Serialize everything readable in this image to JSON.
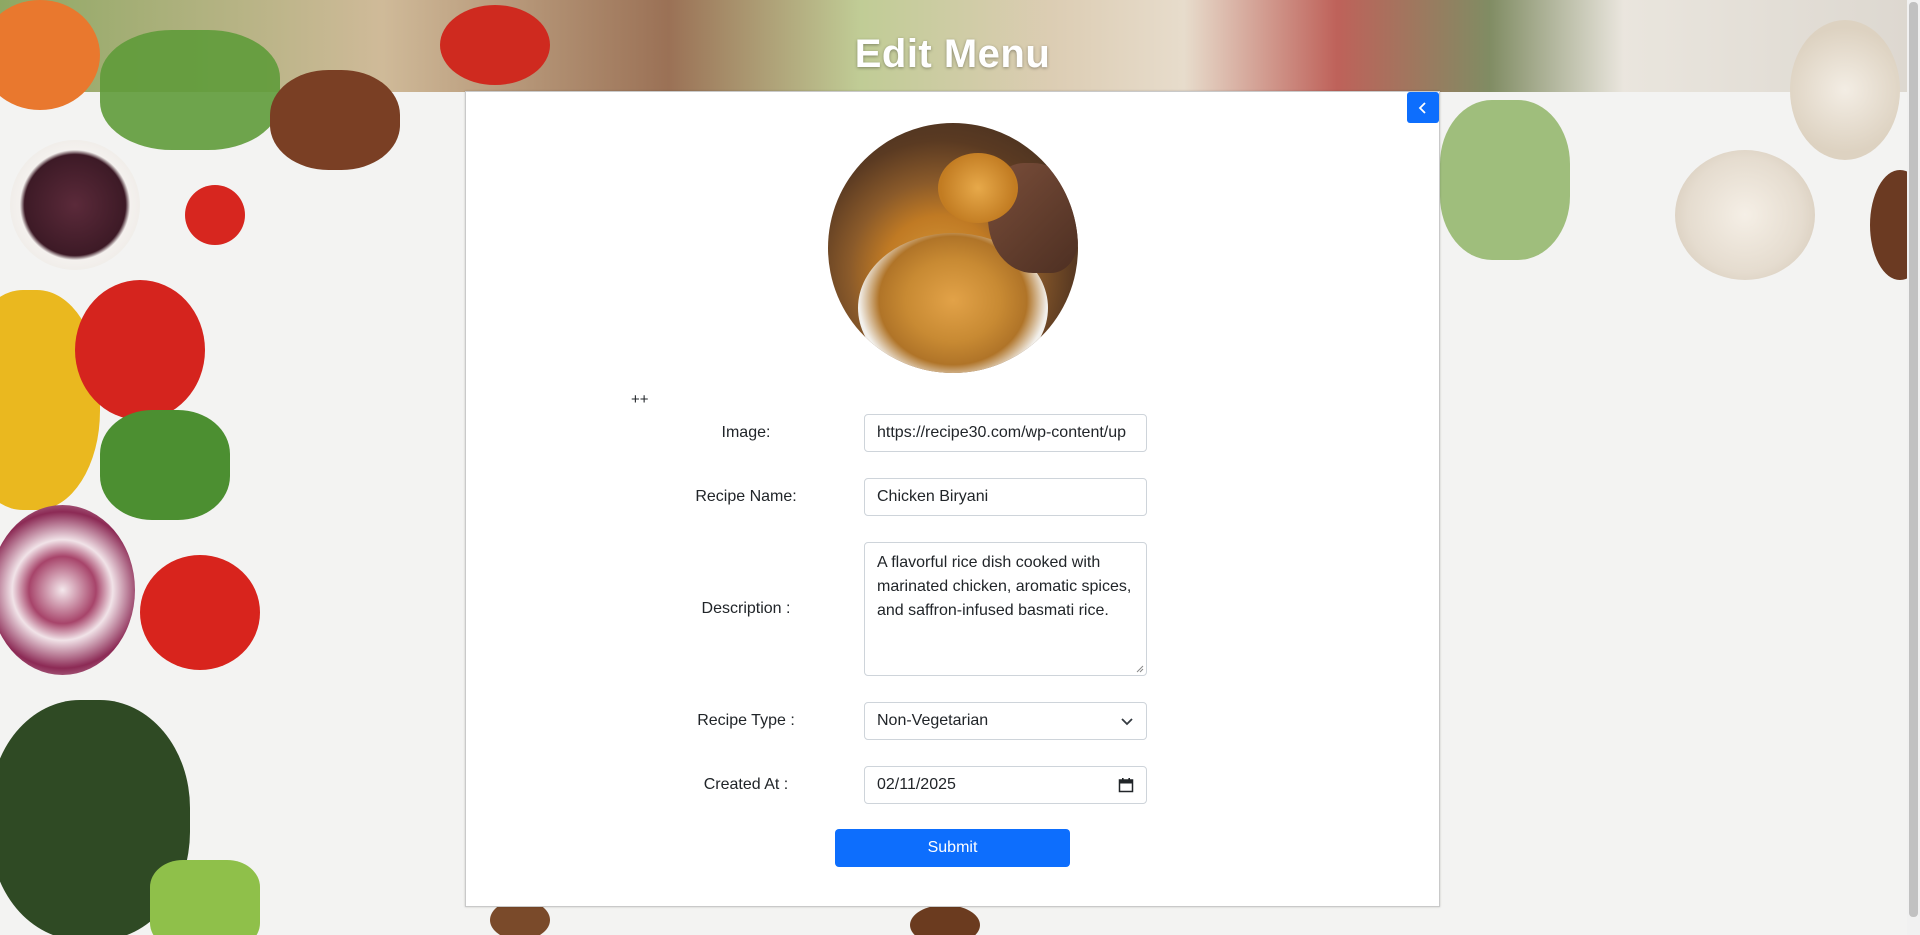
{
  "page": {
    "title": "Edit Menu",
    "plus_text": "++"
  },
  "icons": {
    "back": "chevron-left-icon",
    "select": "chevron-down-icon",
    "date": "calendar-icon"
  },
  "form": {
    "image_label": "Image:",
    "image_value": "https://recipe30.com/wp-content/up",
    "name_label": "Recipe Name:",
    "name_value": "Chicken Biryani",
    "description_label": "Description :",
    "description_value": "A flavorful rice dish cooked with marinated chicken, aromatic spices, and saffron-infused basmati rice.",
    "type_label": "Recipe Type :",
    "type_value": "Non-Vegetarian",
    "created_label": "Created At :",
    "created_value": "02/11/2025",
    "submit_label": "Submit"
  },
  "colors": {
    "primary": "#0d6efd",
    "title_text": "#ffffff"
  }
}
